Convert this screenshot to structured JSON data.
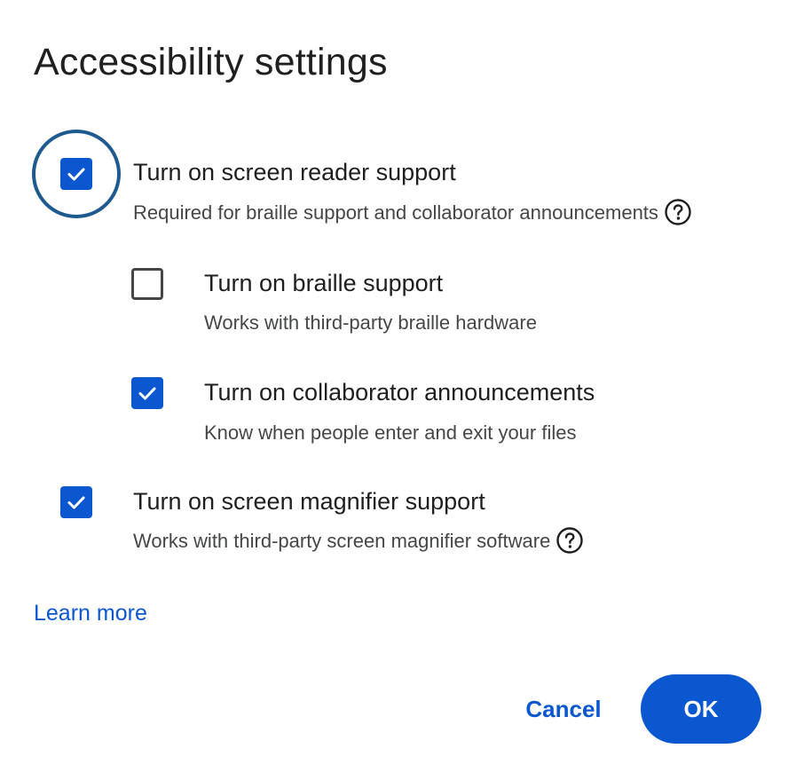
{
  "dialog": {
    "title": "Accessibility settings"
  },
  "options": {
    "screen_reader": {
      "label": "Turn on screen reader support",
      "description": "Required for braille support and collaborator announcements",
      "checked": true,
      "has_help_icon": true
    },
    "braille": {
      "label": "Turn on braille support",
      "description": "Works with third-party braille hardware",
      "checked": false
    },
    "collaborator": {
      "label": "Turn on collaborator announcements",
      "description": "Know when people enter and exit your files",
      "checked": true
    },
    "magnifier": {
      "label": "Turn on screen magnifier support",
      "description": "Works with third-party screen magnifier software",
      "checked": true,
      "has_help_icon": true
    }
  },
  "learn_more": "Learn more",
  "buttons": {
    "cancel": "Cancel",
    "ok": "OK"
  },
  "icons": {
    "check": "check-icon",
    "help": "help-circle-icon"
  },
  "colors": {
    "accent": "#0b57d0",
    "focus_ring": "#1e5a8f",
    "text_primary": "#1f1f1f",
    "text_secondary": "#444746"
  }
}
